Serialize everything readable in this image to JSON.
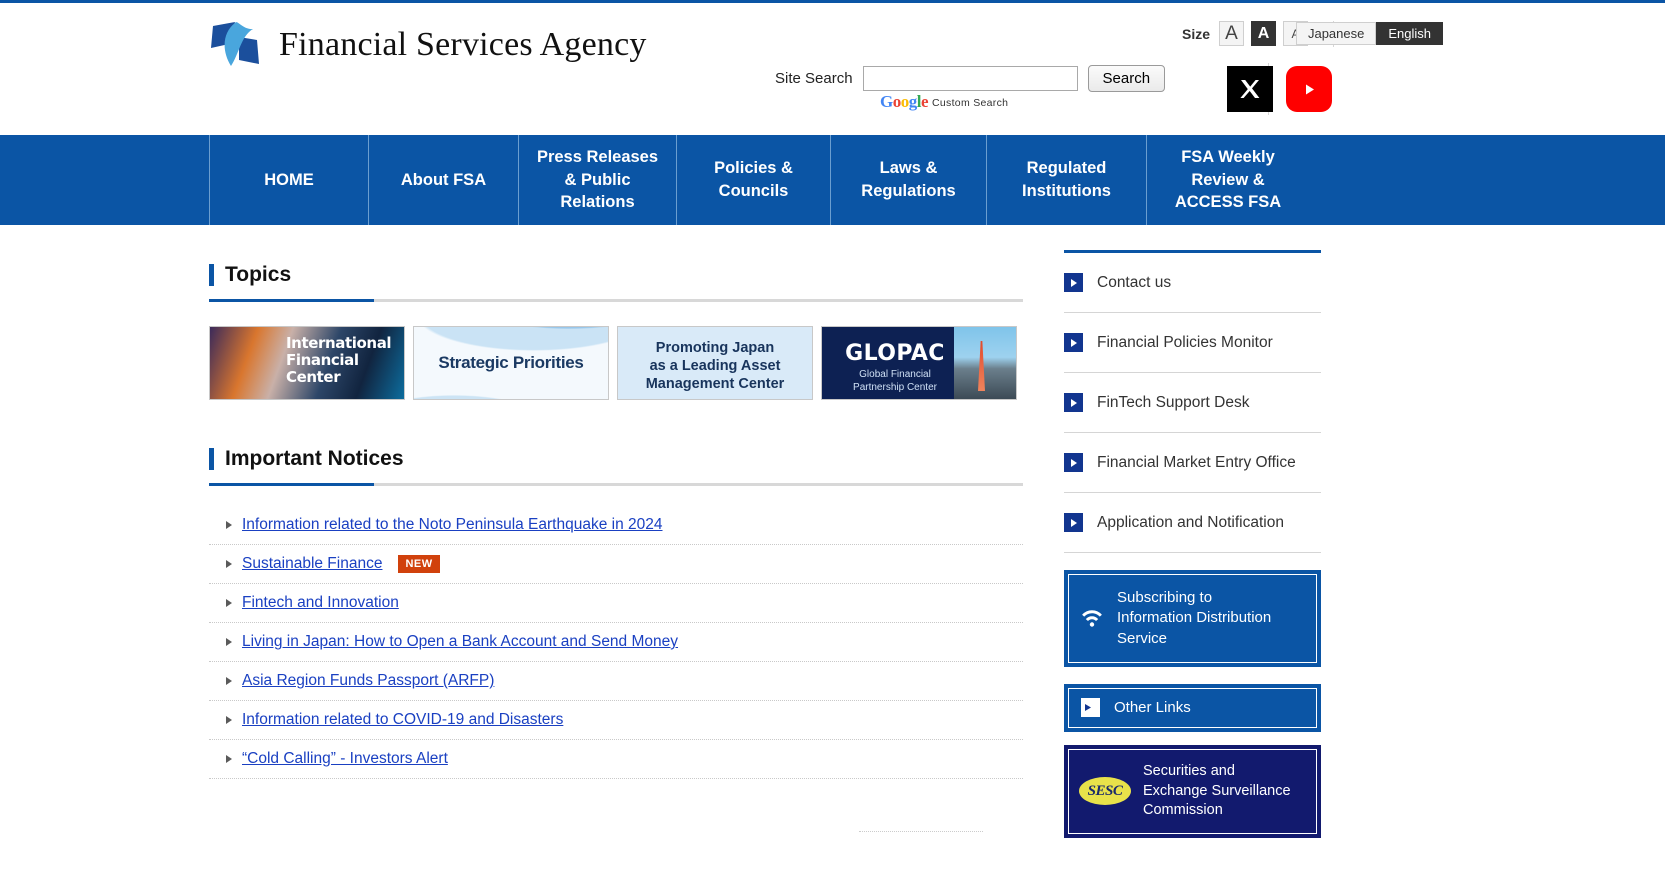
{
  "site": {
    "logo_text": "Financial Services Agency",
    "logo_icon": "fsa-logo-icon"
  },
  "header": {
    "size_label": "Size",
    "size_options": [
      {
        "label": "A",
        "size": "large",
        "selected": false
      },
      {
        "label": "A",
        "size": "medium",
        "selected": true
      },
      {
        "label": "A",
        "size": "small",
        "selected": false
      }
    ],
    "languages": [
      {
        "label": "Japanese",
        "active": false
      },
      {
        "label": "English",
        "active": true
      }
    ],
    "search": {
      "label": "Site Search",
      "value": "",
      "placeholder": "",
      "button": "Search",
      "provider_brand": "Google",
      "provider_tm": "™",
      "provider_suffix": "Custom Search"
    },
    "social": [
      {
        "name": "x-twitter-icon",
        "label": "X"
      },
      {
        "name": "youtube-icon",
        "label": "YouTube"
      }
    ]
  },
  "nav": {
    "items": [
      {
        "label": "HOME",
        "width": "nav-w1"
      },
      {
        "label": "About FSA",
        "width": "nav-w2"
      },
      {
        "label": "Press Releases & Public Relations",
        "width": "nav-w3"
      },
      {
        "label": "Policies & Councils",
        "width": "nav-w4"
      },
      {
        "label": "Laws & Regulations",
        "width": "nav-w5"
      },
      {
        "label": "Regulated Institutions",
        "width": "nav-w6"
      },
      {
        "label": "FSA Weekly Review & ACCESS FSA",
        "width": "nav-w7"
      }
    ]
  },
  "topics": {
    "title": "Topics",
    "banners": [
      {
        "line1": "International",
        "line2": "Financial",
        "line3": "Center"
      },
      {
        "title": "Strategic Priorities"
      },
      {
        "line1": "Promoting Japan",
        "line2": "as a Leading Asset",
        "line3": "Management Center"
      },
      {
        "title": "GLOPAC",
        "subtitle1": "Global Financial",
        "subtitle2": "Partnership Center"
      }
    ]
  },
  "important_notices": {
    "title": "Important Notices",
    "items": [
      {
        "label": "Information related to the Noto Peninsula Earthquake in 2024",
        "badge": ""
      },
      {
        "label": "Sustainable Finance",
        "badge": "NEW"
      },
      {
        "label": "Fintech and Innovation",
        "badge": ""
      },
      {
        "label": "Living in Japan: How to Open a Bank Account and Send Money",
        "badge": ""
      },
      {
        "label": "Asia Region Funds Passport (ARFP)",
        "badge": ""
      },
      {
        "label": "Information related to COVID-19 and Disasters",
        "badge": ""
      },
      {
        "label": "“Cold Calling” - Investors Alert",
        "badge": ""
      }
    ]
  },
  "sidebar": {
    "links": [
      {
        "label": "Contact us"
      },
      {
        "label": "Financial Policies Monitor"
      },
      {
        "label": "FinTech Support Desk"
      },
      {
        "label": "Financial Market Entry Office"
      },
      {
        "label": "Application and Notification"
      }
    ],
    "subscribe_box": {
      "line1": "Subscribing to",
      "line2": "Information Distribution",
      "line3": "Service",
      "icon": "rss-feed-icon"
    },
    "other_links_box": {
      "label": "Other Links"
    },
    "sesc_box": {
      "logo_text": "SESC",
      "line1": "Securities and",
      "line2": "Exchange Surveillance",
      "line3": "Commission"
    }
  },
  "colors": {
    "brand_blue": "#0b55a5",
    "nav_blue": "#0b55a5",
    "link_blue": "#1a40c2",
    "badge_new": "#d1410c",
    "sesc_navy": "#121a6e"
  }
}
